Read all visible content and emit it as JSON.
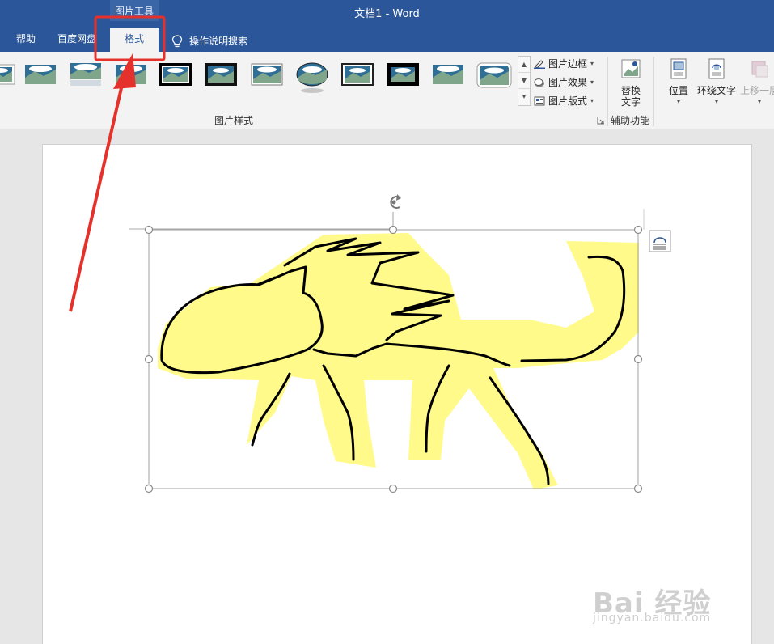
{
  "window": {
    "title": "文档1  -  Word",
    "context_tools_label": "图片工具"
  },
  "tabs": [
    {
      "label": "帮助"
    },
    {
      "label": "百度网盘"
    },
    {
      "label": "格式"
    },
    {
      "label": "操作说明搜索"
    }
  ],
  "ribbon": {
    "picture_styles_label": "图片样式",
    "picture_border": "图片边框",
    "picture_effects": "图片效果",
    "picture_layout": "图片版式",
    "alt_text_line1": "替换",
    "alt_text_line2": "文字",
    "accessibility_label": "辅助功能",
    "position": "位置",
    "wrap_text": "环绕文字",
    "bring_forward": "上移一层"
  },
  "watermark": {
    "brand": "Bai  经验",
    "url": "jingyan.baidu.com"
  },
  "colors": {
    "title_blue": "#2b579a",
    "annotation_red": "#e5312b",
    "drawing_fill": "#fffa8a"
  },
  "icons": [
    "lightbulb-icon",
    "picture-border-icon",
    "picture-effects-icon",
    "picture-layout-icon",
    "alt-text-icon",
    "position-icon",
    "wrap-text-icon",
    "bring-forward-icon",
    "rotate-handle-icon",
    "layout-options-icon",
    "dialog-launcher-icon"
  ]
}
